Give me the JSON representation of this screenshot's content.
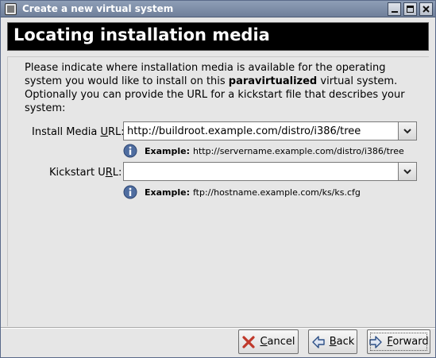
{
  "window": {
    "title": "Create a new virtual system"
  },
  "banner": {
    "title": "Locating installation media"
  },
  "intro": {
    "part1": "Please indicate where installation media is available for the operating system you would like to install on this ",
    "bold": "paravirtualized",
    "part2": " virtual system. Optionally you can provide the URL for a kickstart file that describes your system:"
  },
  "install_media": {
    "label_before": "Install Media ",
    "label_mnemonic": "U",
    "label_after": "RL:",
    "value": "http://buildroot.example.com/distro/i386/tree",
    "hint_bold": "Example:",
    "hint_text": "http://servername.example.com/distro/i386/tree"
  },
  "kickstart": {
    "label_before": "Kickstart U",
    "label_mnemonic": "R",
    "label_after": "L:",
    "value": "",
    "hint_bold": "Example:",
    "hint_text": "ftp://hostname.example.com/ks/ks.cfg"
  },
  "buttons": {
    "cancel_mnemonic": "C",
    "cancel_rest": "ancel",
    "back_mnemonic": "B",
    "back_rest": "ack",
    "forward_mnemonic": "F",
    "forward_rest": "orward"
  },
  "icons": {
    "window": "window-icon",
    "minimize": "minimize-icon",
    "maximize": "maximize-icon",
    "close": "close-icon",
    "dropdown": "chevron-down-icon",
    "info": "info-icon",
    "cancel": "cancel-x-icon",
    "back": "arrow-left-icon",
    "forward": "arrow-right-icon"
  },
  "colors": {
    "titlebar": "#7f8fa9",
    "banner_bg": "#000000",
    "banner_text": "#ffffff",
    "window_bg": "#e6e6e6",
    "info_icon": "#4f6da0",
    "cancel_icon": "#c0392b",
    "arrow_icon": "#2c4f86"
  }
}
